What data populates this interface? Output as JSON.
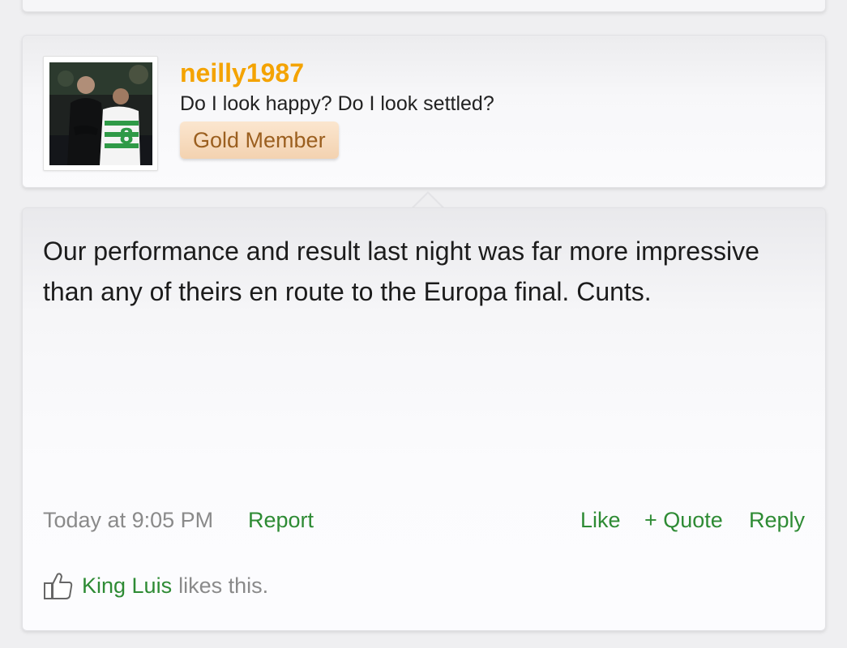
{
  "author": {
    "username": "neilly1987",
    "title": "Do I look happy? Do I look settled?",
    "badge": "Gold Member",
    "avatar_icon": "avatar-photo"
  },
  "post": {
    "message": "Our performance and result last night was far more impressive than any of theirs en route to the Europa final. Cunts.",
    "timestamp": "Today at 9:05 PM",
    "report_label": "Report",
    "like_label": "Like",
    "quote_label": "+ Quote",
    "reply_label": "Reply"
  },
  "likes": {
    "icon": "thumbs-up-icon",
    "user": "King Luis",
    "text": "likes this."
  },
  "colors": {
    "username": "#f4a300",
    "link": "#2e8b34",
    "muted": "#8a8a8a",
    "badge_text": "#9b5f1f"
  }
}
